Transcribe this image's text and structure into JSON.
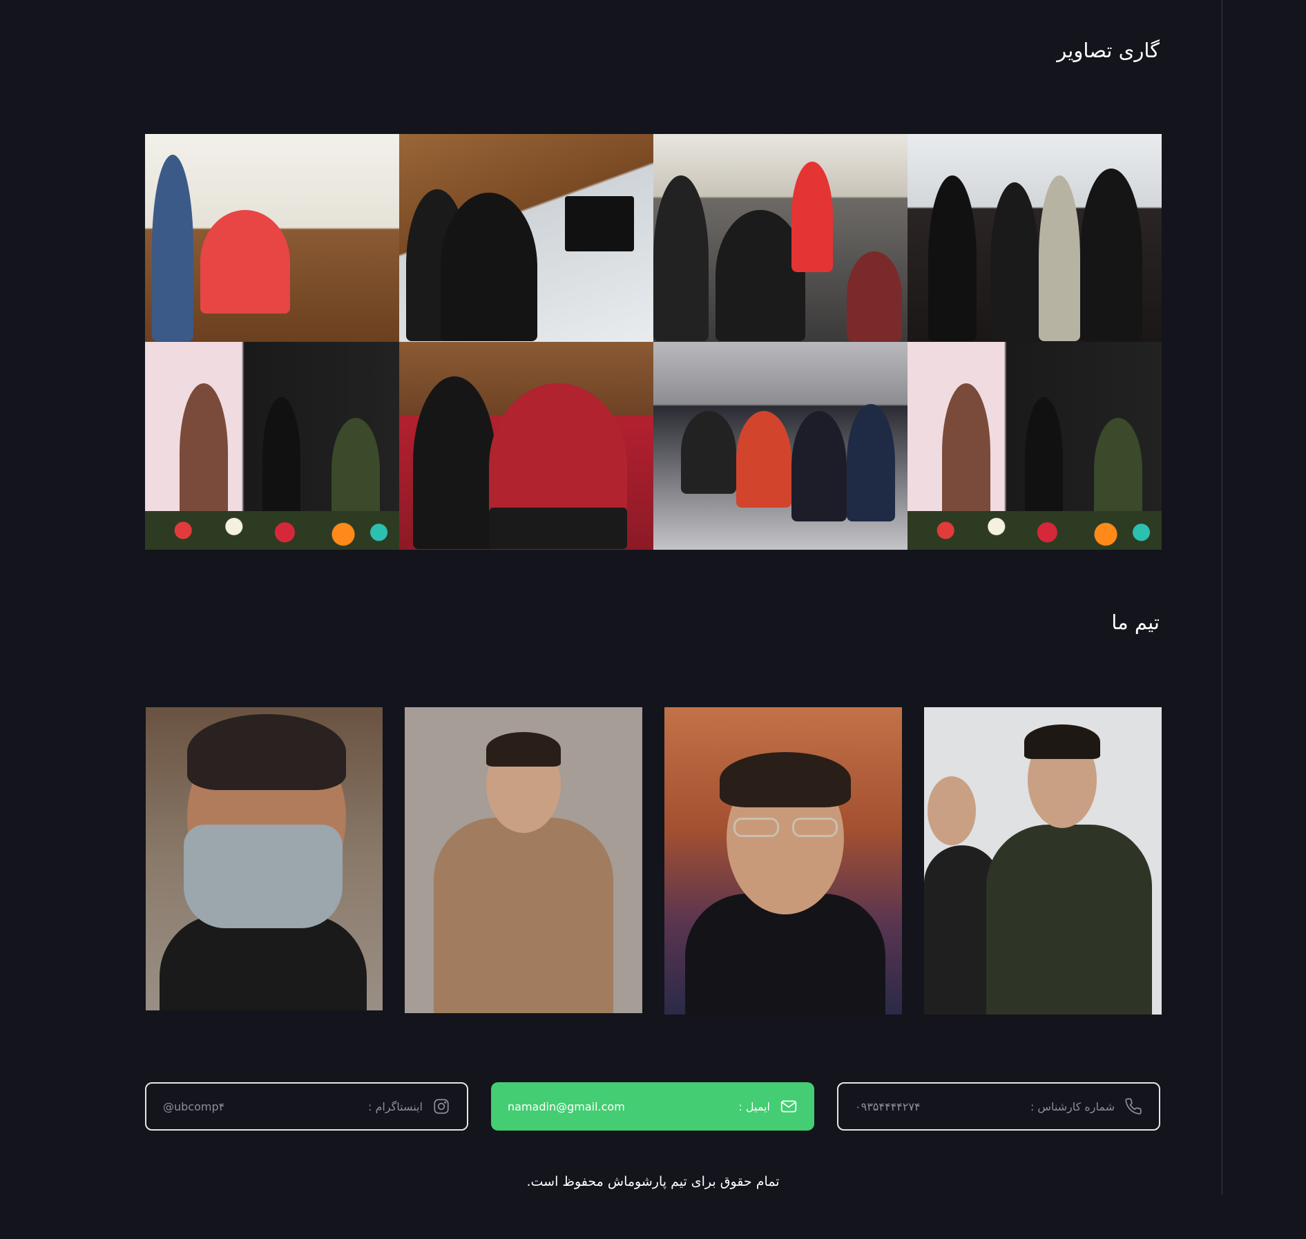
{
  "gallery": {
    "title": "گاری تصاویر",
    "photos": [
      "photo-1",
      "photo-2",
      "photo-3",
      "photo-4",
      "photo-5",
      "photo-6",
      "photo-7",
      "photo-8"
    ]
  },
  "team": {
    "title": "تیم ما"
  },
  "contacts": {
    "phone": {
      "icon": "phone-icon",
      "label": "شماره کارشناس :",
      "value": "۰۹۳۵۴۴۴۴۲۷۴"
    },
    "email": {
      "icon": "mail-icon",
      "label": "ایمیل :",
      "value": "namadin@gmail.com"
    },
    "instagram": {
      "icon": "instagram-icon",
      "label": "اینستاگرام :",
      "value": "@ubcomp۴"
    }
  },
  "footer": {
    "copyright": "تمام حقوق برای تیم پارشوماش محفوظ است."
  },
  "colors": {
    "background": "#13141c",
    "accent_green": "#44cd72",
    "card_border": "#e6e6ea",
    "muted_text": "#8d8e96"
  }
}
